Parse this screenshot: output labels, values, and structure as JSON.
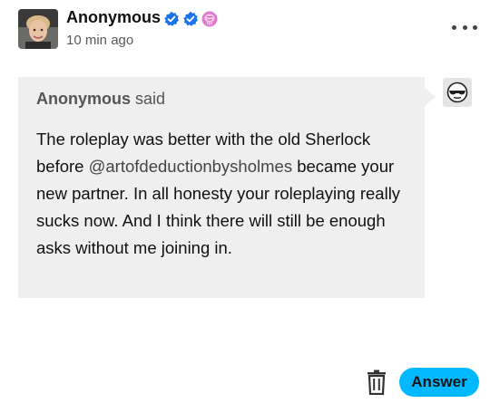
{
  "post": {
    "author_name": "Anonymous",
    "timestamp": "10 min ago",
    "badges": [
      "verified-check-icon",
      "verified-check-icon",
      "pink-brain-icon"
    ]
  },
  "ask": {
    "asker_name": "Anonymous",
    "said_label": "said",
    "text_before": "The roleplay was better with the old Sherlock before ",
    "mention": "@artofdeductionbysholmes",
    "text_after": " became your new partner. In all honesty your roleplaying really sucks now. And I think there will still be enough asks without me joining in."
  },
  "actions": {
    "answer_label": "Answer"
  },
  "colors": {
    "accent": "#00b8ff",
    "bubble": "#efefef",
    "badge_blue": "#1a73e8",
    "badge_pink": "#e07ad0"
  }
}
